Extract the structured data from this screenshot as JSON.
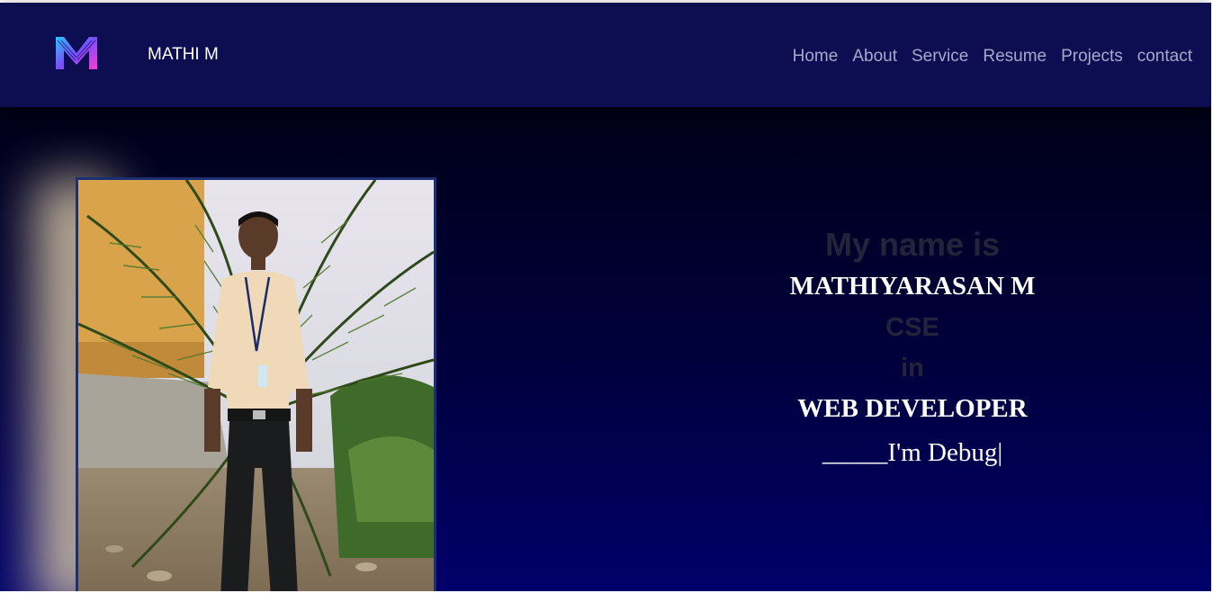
{
  "brand": {
    "name": "MATHI M",
    "logo": "m-logo-icon"
  },
  "nav": {
    "items": [
      "Home",
      "About",
      "Service",
      "Resume",
      "Projects",
      "contact"
    ]
  },
  "hero": {
    "intro": "My name is",
    "name": "MATHIYARASAN M",
    "dept": "CSE",
    "connector": "in",
    "role": "WEB DEVELOPER",
    "typed": "_____I'm Debug|"
  },
  "colors": {
    "navbar": "#0d0d52",
    "nav_link": "#a8a8cc",
    "hero_top": "#000018",
    "hero_bottom": "#00006a",
    "muted_text": "#23233a",
    "photo_border": "#1d2f73"
  }
}
